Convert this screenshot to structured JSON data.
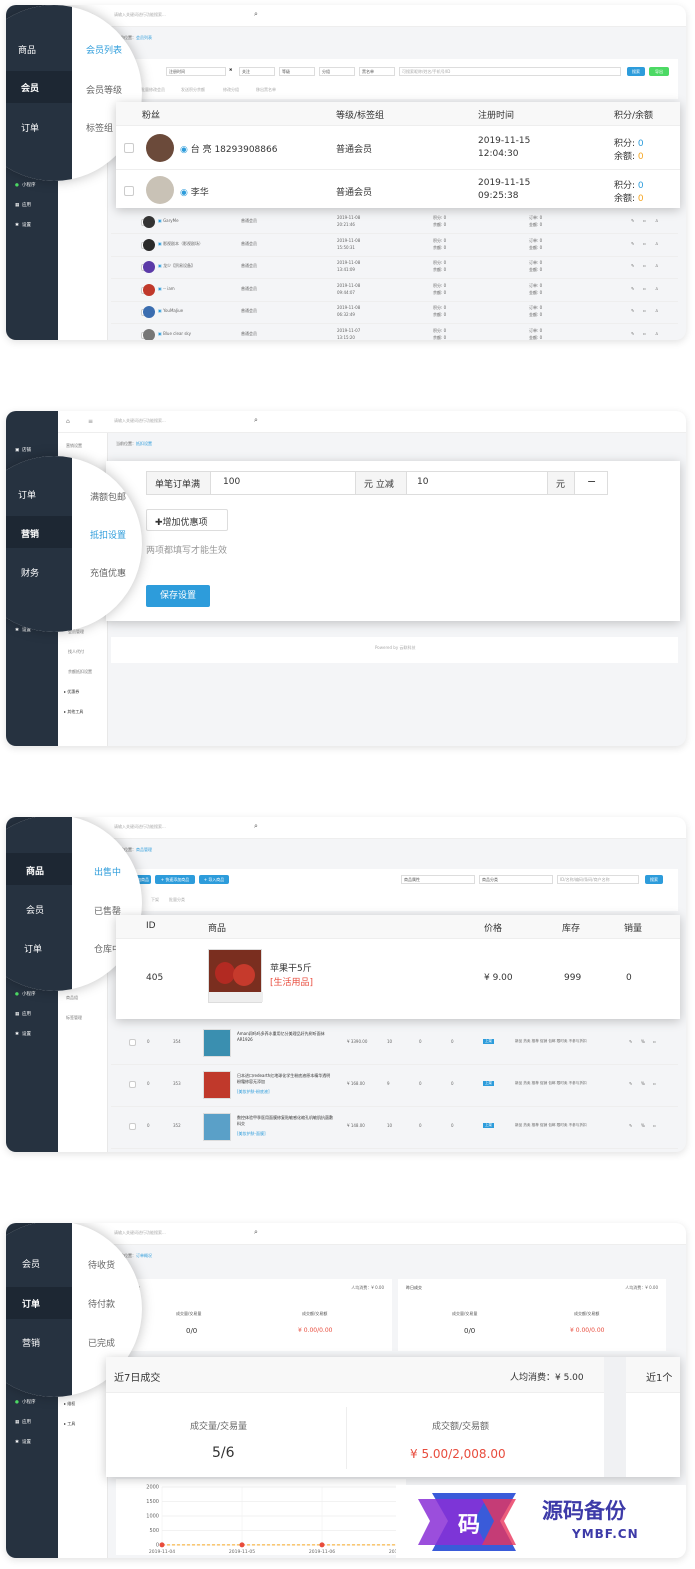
{
  "common": {
    "search_placeholder": "请输入关键词进行功能搜索...",
    "crumb_prefix": "当前位置：",
    "home_icon": "⌂",
    "menu_icon": "≡",
    "search_icon": "⌕"
  },
  "p1": {
    "crumb": "会员列表",
    "sidebar": [
      "财务",
      "数据",
      "小程序",
      "应用",
      "设置"
    ],
    "circle_left": [
      "商品",
      "会员",
      "订单"
    ],
    "circle_right": [
      "会员列表",
      "会员等级",
      "标签组"
    ],
    "filters": {
      "time": "注册时间",
      "follow": "关注",
      "level": "等级",
      "group": "分组",
      "blacklist": "黑名单",
      "placeholder": "可搜索昵称/姓名/手机号/ID",
      "search_btn": "搜索",
      "export_btn": "导出"
    },
    "actions": [
      "批量修改会员",
      "发送积分余额",
      "修改分组",
      "移出黑名单"
    ],
    "zoom_headers": [
      "粉丝",
      "等级/标签组",
      "注册时间",
      "积分/余额"
    ],
    "zoom_rows": [
      {
        "name": "台 亮 18293908866",
        "level": "普通会员",
        "date": "2019-11-15",
        "time": "12:04:30",
        "points_label": "积分:",
        "points": "0",
        "balance_label": "余额:",
        "balance": "0"
      },
      {
        "name": "李华",
        "level": "普通会员",
        "date": "2019-11-15",
        "time": "09:25:38",
        "points_label": "积分:",
        "points": "0",
        "balance_label": "余额:",
        "balance": "0"
      }
    ],
    "rows": [
      {
        "name": "GaryMe",
        "level": "普通会员",
        "date": "2019-11-08",
        "time": "20:21:46",
        "p": "积分: 0",
        "b": "余额: 0",
        "o": "订单: 0",
        "m": "金额: 0"
      },
      {
        "name": "影视剧本（影视剧场）",
        "level": "普通会员",
        "date": "2019-11-08",
        "time": "15:50:31",
        "p": "积分: 0",
        "b": "余额: 0",
        "o": "订单: 0",
        "m": "金额: 0"
      },
      {
        "name": "龙少【贸易设备】",
        "level": "普通会员",
        "date": "2019-11-08",
        "time": "13:41:09",
        "p": "积分: 0",
        "b": "余额: 0",
        "o": "订单: 0",
        "m": "金额: 0"
      },
      {
        "name": "-- iam",
        "level": "普通会员",
        "date": "2019-11-08",
        "time": "09:44:07",
        "p": "积分: 0",
        "b": "余额: 0",
        "o": "订单: 0",
        "m": "金额: 0"
      },
      {
        "name": "YouMaJiue",
        "level": "普通会员",
        "date": "2019-11-08",
        "time": "06:32:49",
        "p": "积分: 0",
        "b": "余额: 0",
        "o": "订单: 0",
        "m": "金额: 0"
      },
      {
        "name": "Blue clear sky",
        "level": "普通会员",
        "date": "2019-11-07",
        "time": "13:15:20",
        "p": "积分: 0",
        "b": "余额: 0",
        "o": "订单: 0",
        "m": "金额: 0"
      }
    ]
  },
  "p2": {
    "crumb": "抵扣设置",
    "sidebar_top": [
      "店铺",
      "商品"
    ],
    "sidebar_bottom": [
      "小程序",
      "应用",
      "设置"
    ],
    "sub_top": "营销设置",
    "sub_items": [
      "插件管理",
      "会员管理",
      "找人代付",
      "余额抵扣设置",
      "优惠券",
      "其他工具"
    ],
    "circle_left": [
      "订单",
      "营销",
      "财务"
    ],
    "circle_right": [
      "满额包邮",
      "抵扣设置",
      "充值优惠"
    ],
    "form": {
      "label1": "单笔订单满",
      "value1": "100",
      "label2": "元 立减",
      "value2": "10",
      "unit": "元",
      "remove": "−",
      "add_btn": "增加优惠项",
      "hint": "两项都填写才能生效",
      "save_btn": "保存设置"
    },
    "footer": "Powered by 云联科技"
  },
  "p3": {
    "crumb": "商品管理",
    "sidebar": [
      "数据",
      "小程序",
      "应用",
      "设置"
    ],
    "sub_items": [
      "商品分类",
      "商品组",
      "标签管理"
    ],
    "circle_left": [
      "商品",
      "会员",
      "订单"
    ],
    "circle_right": [
      "出售中",
      "已售罄",
      "仓库中"
    ],
    "tool_btns": [
      "添加商品",
      "快速添加商品",
      "导入商品"
    ],
    "filters": {
      "attr": "商品属性",
      "cat": "商品分类",
      "placeholder": "ID/名称/编码/条码/商户名称",
      "search_btn": "搜索"
    },
    "tabs": [
      "下架",
      "批量分类"
    ],
    "zoom_headers": [
      "ID",
      "商品",
      "价格",
      "库存",
      "销量"
    ],
    "zoom_row": {
      "id": "405",
      "name": "苹果干5斤",
      "cat": "[生活用品]",
      "price": "¥ 9.00",
      "stock": "999",
      "sales": "0"
    },
    "rows": [
      {
        "id": "354",
        "name": "Aman润吗吗多养水重用亿分美理品好先树听面抹AR1926",
        "cat": "",
        "price": "¥ 3390.00",
        "stock": "10",
        "sales": "0",
        "extra": "0",
        "tags": "新品 热卖 推荐 促销 包邮 限时卖 不参与折扣"
      },
      {
        "id": "353",
        "name": "日本进口redearth红地球化学生粉底液原本精华透明粉霜修容无添加",
        "cat": "[美妆护肤-粉底液]",
        "price": "¥ 168.00",
        "stock": "9",
        "sales": "0",
        "extra": "0",
        "tags": "新品 热卖 推荐 促销 包邮 限时卖 不参与折扣"
      },
      {
        "id": "352",
        "name": "数控体验甲季医用面膜修复贴敏感化缩孔机敏肌抗菌敷料交",
        "cat": "[美妆护肤-面膜]",
        "price": "¥ 148.00",
        "stock": "10",
        "sales": "0",
        "extra": "0",
        "tags": "新品 热卖 推荐 促销 包邮 限时卖 不参与折扣"
      }
    ],
    "status_tag": "上架"
  },
  "p4": {
    "crumb": "订单概况",
    "sidebar": [
      "财务",
      "数据",
      "小程序",
      "应用",
      "设置"
    ],
    "sub_items": [
      "全部订单",
      "维权",
      "工具"
    ],
    "circle_left": [
      "会员",
      "订单",
      "营销"
    ],
    "circle_right": [
      "待收货",
      "待付款",
      "已完成"
    ],
    "card_today": {
      "title": "今日成交",
      "avg": "人均消费：¥ 0.00",
      "l1": "成交量/交易量",
      "v1": "0/0",
      "l2": "成交额/交易额",
      "v2": "¥ 0.00/0.00"
    },
    "card_yest": {
      "title": "昨日成交",
      "avg": "人均消费：¥ 0.00",
      "l1": "成交量/交易量",
      "v1": "0/0",
      "l2": "成交额/交易额",
      "v2": "¥ 0.00/0.00"
    },
    "zoom": {
      "title": "近7日成交",
      "avg": "人均消费：¥ 5.00",
      "l1": "成交量/交易量",
      "v1": "5/6",
      "l2": "成交额/交易额",
      "v2": "¥ 5.00/2,008.00",
      "next": "近1个"
    },
    "chart_data": {
      "type": "line",
      "x": [
        "2019-11-04",
        "2019-11-05",
        "2019-11-06",
        "2019-11-07"
      ],
      "series": [
        {
          "values": [
            5,
            5,
            5,
            5
          ]
        }
      ],
      "yticks": [
        0,
        500,
        1000,
        1500,
        2000
      ],
      "ylim": [
        0,
        2000
      ],
      "grid": true
    },
    "logo_text": "源码备份",
    "logo_url": "YMBF.CN",
    "logo_char": "码"
  }
}
